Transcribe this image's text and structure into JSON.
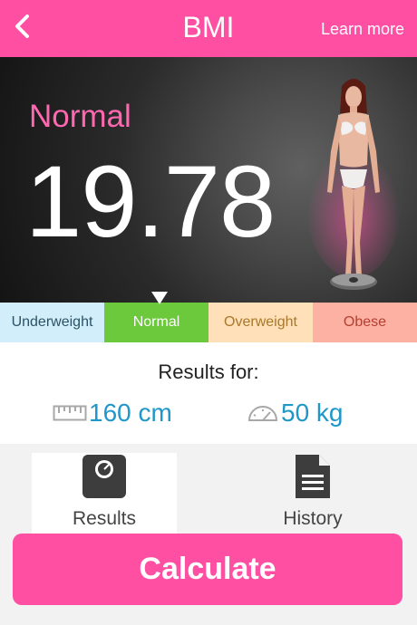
{
  "header": {
    "title": "BMI",
    "learn_more": "Learn more",
    "back_icon": "chevron-left-icon"
  },
  "hero": {
    "status": "Normal",
    "bmi_value": "19.78",
    "status_color": "#ff68b0"
  },
  "categories": [
    {
      "label": "Underweight",
      "color": "#d2eefb"
    },
    {
      "label": "Normal",
      "color": "#6cc93b",
      "selected": true
    },
    {
      "label": "Overweight",
      "color": "#ffe0b8"
    },
    {
      "label": "Obese",
      "color": "#fdb1a3"
    }
  ],
  "results": {
    "heading": "Results for:",
    "height": "160 cm",
    "weight": "50 kg",
    "height_icon": "ruler-icon",
    "weight_icon": "speedometer-icon"
  },
  "nav": {
    "results_label": "Results",
    "history_label": "History",
    "results_icon": "scale-icon",
    "history_icon": "document-icon"
  },
  "actions": {
    "calculate": "Calculate"
  },
  "colors": {
    "brand": "#ff4fa3",
    "accent_blue": "#1f97c9"
  }
}
